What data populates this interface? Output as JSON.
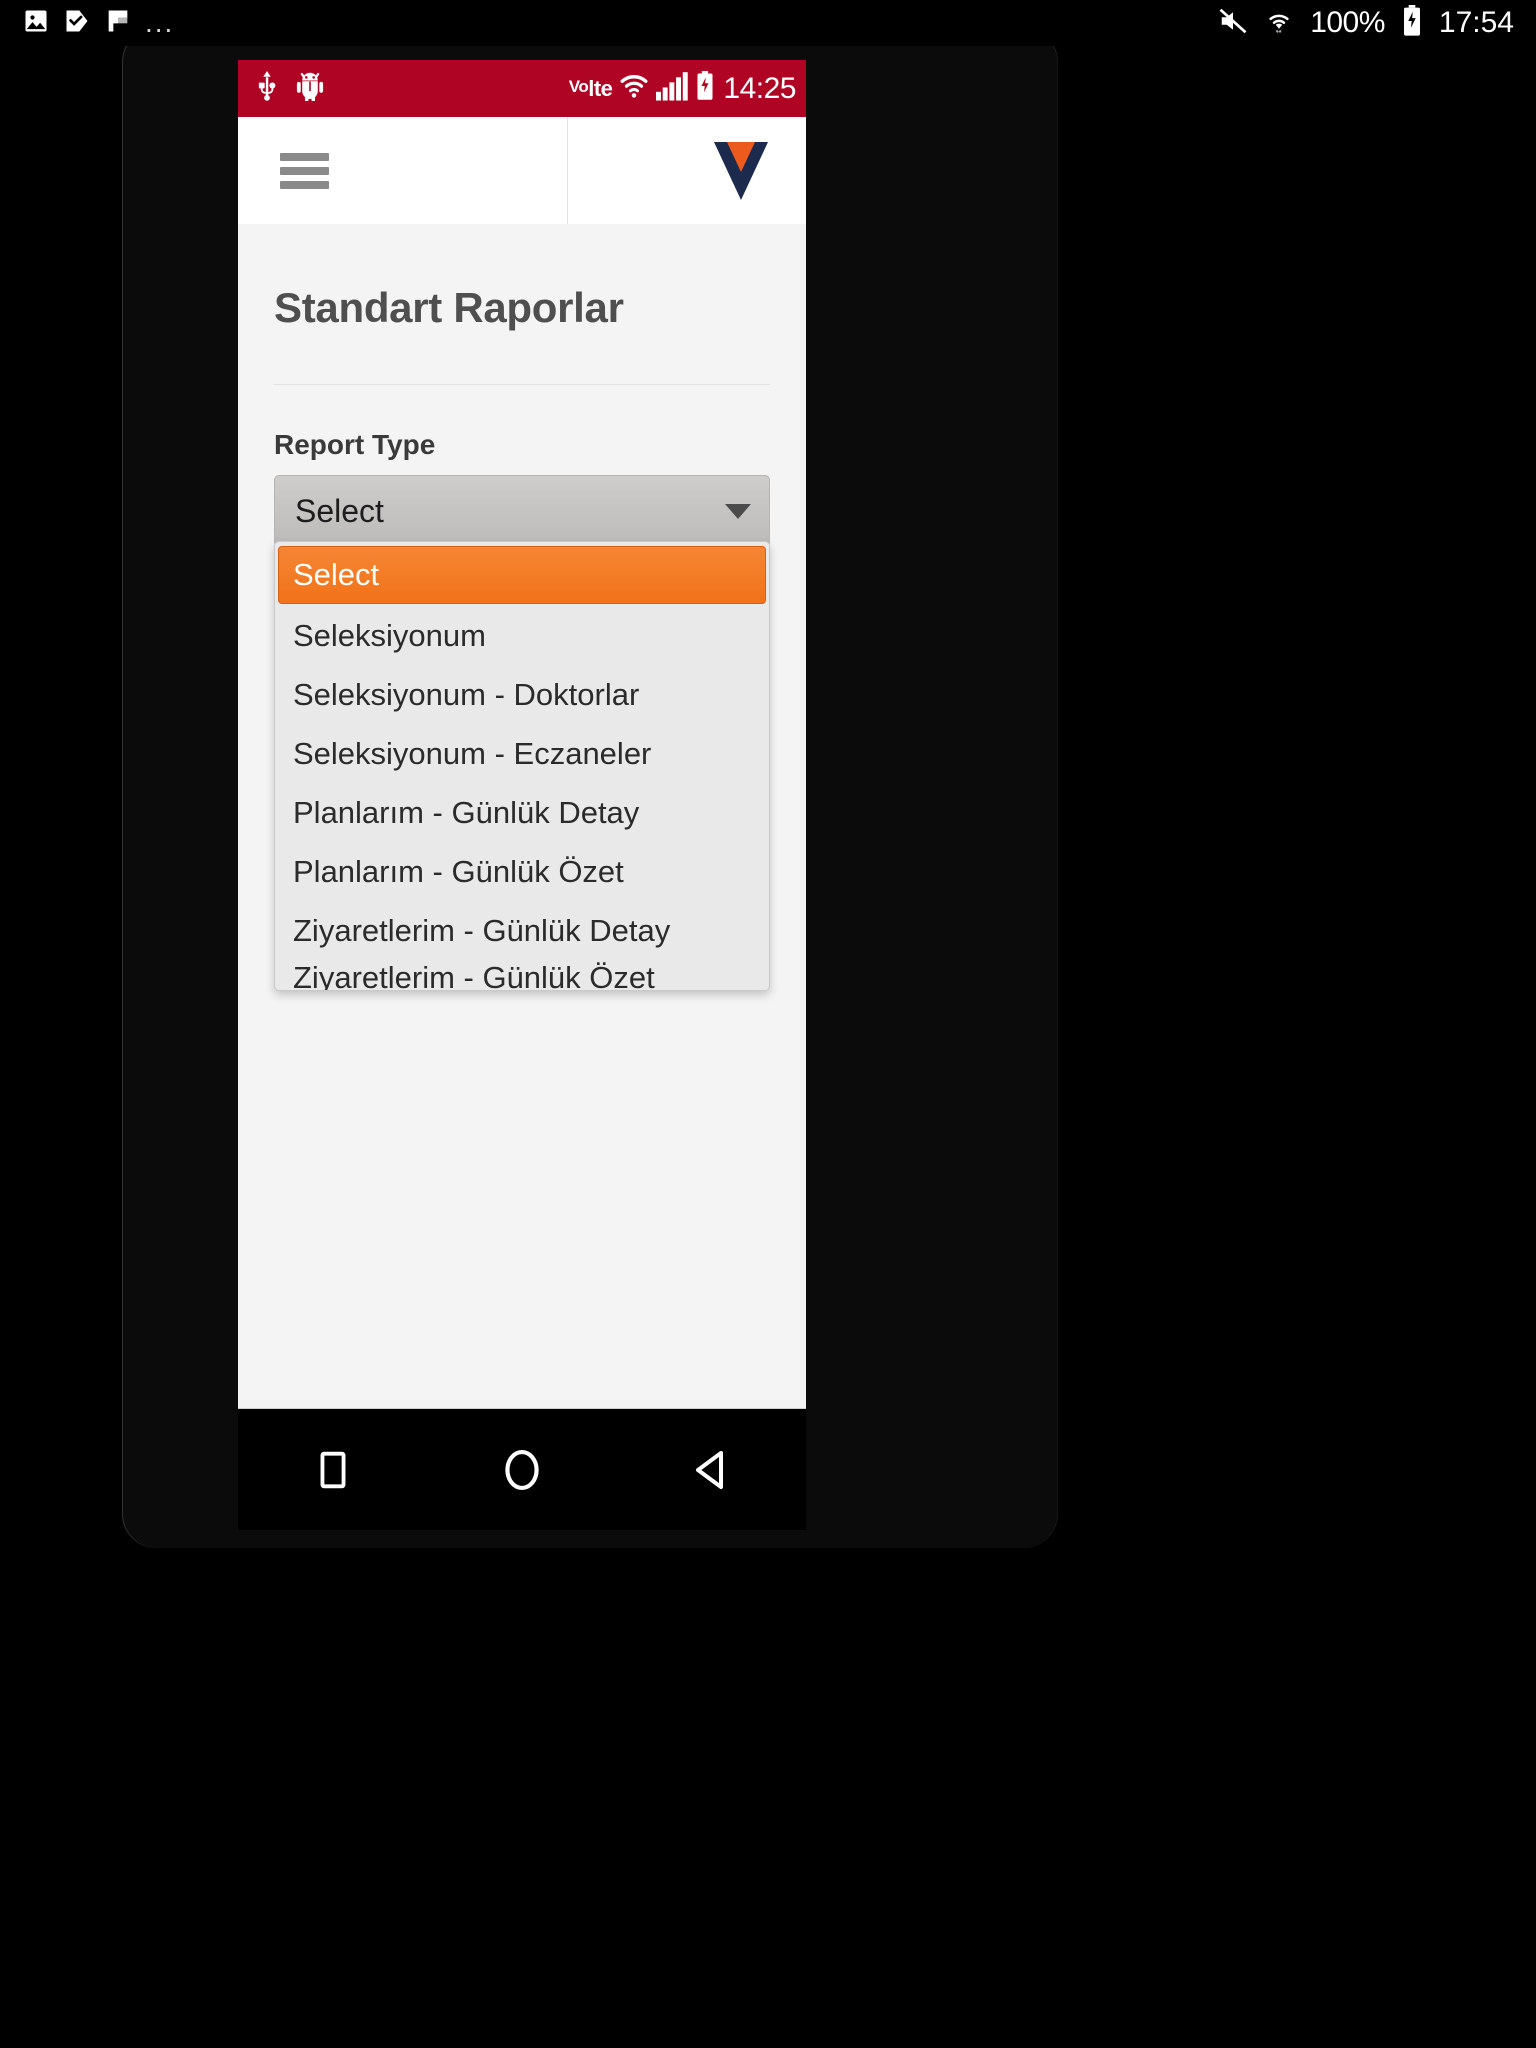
{
  "os_statusbar": {
    "left_icons": [
      "image-icon",
      "video-check-icon",
      "flag-icon"
    ],
    "overflow": "...",
    "right_icons": [
      "mute-icon",
      "wifi-icon",
      "battery-charging-icon"
    ],
    "battery_percent": "100%",
    "clock": "17:54"
  },
  "app_statusbar": {
    "left_icons": [
      "usb-icon",
      "android-bug-icon"
    ],
    "network_label": "lte",
    "network_prefix": "Vo",
    "right_icons": [
      "wifi-icon",
      "signal-bars-icon",
      "battery-charging-icon"
    ],
    "clock": "14:25",
    "background_color": "#b00424"
  },
  "header": {
    "menu_icon": "hamburger-menu-icon",
    "logo_icon": "v-logo-icon",
    "logo_outer_color": "#1c2a4d",
    "logo_inner_color": "#ec5a1e"
  },
  "page": {
    "title": "Standart Raporlar",
    "background_color": "#f4f4f4"
  },
  "form": {
    "report_type": {
      "label": "Report Type",
      "selected_value": "Select",
      "arrow_icon": "chevron-down-icon",
      "open": true,
      "highlight_color": "#f1721a",
      "options": [
        "Select",
        "Seleksiyonum",
        "Seleksiyonum - Doktorlar",
        "Seleksiyonum - Eczaneler",
        "Planlarım - Günlük Detay",
        "Planlarım - Günlük Özet",
        "Ziyaretlerim - Günlük Detay",
        "Ziyaretlerim - Günlük Özet"
      ]
    }
  },
  "navbar": {
    "recents_label": "recents-square-icon",
    "home_label": "home-circle-icon",
    "back_label": "back-triangle-icon"
  }
}
